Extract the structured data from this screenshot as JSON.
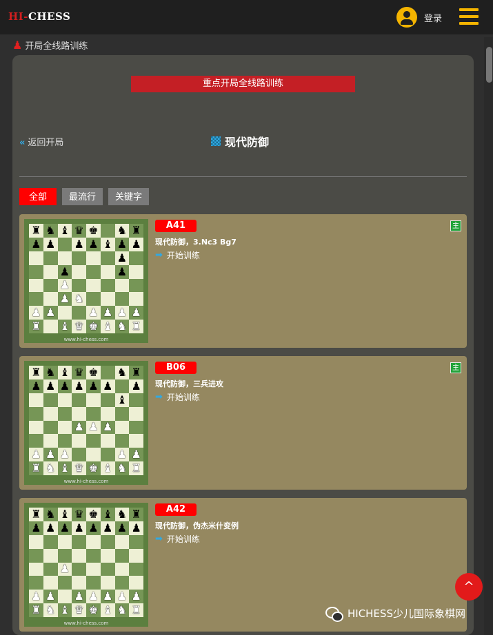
{
  "header": {
    "logo_hi": "HI",
    "logo_dash": "-",
    "logo_chess": "CHESS",
    "login_label": "登录"
  },
  "breadcrumb": {
    "label": "开局全线路训练"
  },
  "panel": {
    "banner": "重点开局全线路训练",
    "back_label": "返回开局",
    "back_icon": "«",
    "title": "现代防御"
  },
  "filters": [
    {
      "label": "全部",
      "active": true
    },
    {
      "label": "最流行",
      "active": false
    },
    {
      "label": "关键字",
      "active": false
    }
  ],
  "cards": [
    {
      "code": "A41",
      "line": "现代防御，3.Nc3 Bg7",
      "action": "开始训练",
      "badge": "主",
      "watermark": "www.hi-chess.com",
      "board": [
        "rnbqk.nr",
        "pp.ppbpp",
        "......p.",
        "..p...p.",
        "..P.....",
        "..PN....",
        "PP..PPPP",
        "R.BQKBNR"
      ]
    },
    {
      "code": "B06",
      "line": "现代防御，三兵进攻",
      "action": "开始训练",
      "badge": "主",
      "watermark": "www.hi-chess.com",
      "board": [
        "rnbqk.nr",
        "pppppp.p",
        "......b.",
        "........",
        "...PPP..",
        "........",
        "PPP...PP",
        "RNBQKBNR"
      ]
    },
    {
      "code": "A42",
      "line": "现代防御，伪杰米什变例",
      "action": "开始训练",
      "badge": "",
      "watermark": "www.hi-chess.com",
      "board": [
        "rnbqkbnr",
        "pppppppp",
        "........",
        "........",
        "..P.....",
        "........",
        "PP.PPPPP",
        "RNBQKBNR"
      ]
    }
  ],
  "footer": {
    "fab_icon": "^",
    "wechat_label": "HICHESS少儿国际象棋网"
  },
  "colors": {
    "accent_red": "#ff0000",
    "banner_red": "#c41f25",
    "link_blue": "#32a8e0",
    "card_bg": "#958860",
    "badge_green": "#22a33a"
  }
}
